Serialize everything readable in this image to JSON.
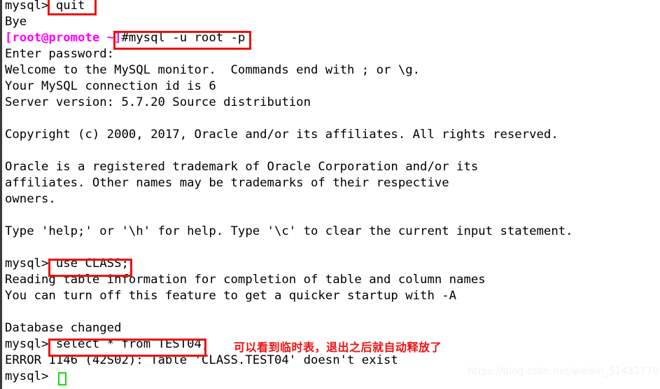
{
  "terminal": {
    "background_color": "#ffffff",
    "text_color": "#000000",
    "prompt_color": "#ff00ff",
    "annotation_color": "#ee1111",
    "cursor_color": "#11dd11",
    "lines": [
      {
        "prompt": "mysql>",
        "text": " quit"
      },
      {
        "prompt": "",
        "text": "Bye"
      },
      {
        "prompt": "[root@promote ~]",
        "text": "#mysql -u root -p"
      },
      {
        "prompt": "",
        "text": "Enter password:"
      },
      {
        "prompt": "",
        "text": "Welcome to the MySQL monitor.  Commands end with ; or \\g."
      },
      {
        "prompt": "",
        "text": "Your MySQL connection id is 6"
      },
      {
        "prompt": "",
        "text": "Server version: 5.7.20 Source distribution"
      },
      {
        "prompt": "",
        "text": ""
      },
      {
        "prompt": "",
        "text": "Copyright (c) 2000, 2017, Oracle and/or its affiliates. All rights reserved."
      },
      {
        "prompt": "",
        "text": ""
      },
      {
        "prompt": "",
        "text": "Oracle is a registered trademark of Oracle Corporation and/or its"
      },
      {
        "prompt": "",
        "text": "affiliates. Other names may be trademarks of their respective"
      },
      {
        "prompt": "",
        "text": "owners."
      },
      {
        "prompt": "",
        "text": ""
      },
      {
        "prompt": "",
        "text": "Type 'help;' or '\\h' for help. Type '\\c' to clear the current input statement."
      },
      {
        "prompt": "",
        "text": ""
      },
      {
        "prompt": "mysql>",
        "text": " use CLASS;"
      },
      {
        "prompt": "",
        "text": "Reading table information for completion of table and column names"
      },
      {
        "prompt": "",
        "text": "You can turn off this feature to get a quicker startup with -A"
      },
      {
        "prompt": "",
        "text": ""
      },
      {
        "prompt": "",
        "text": "Database changed"
      },
      {
        "prompt": "mysql>",
        "text": " select * from TEST04;"
      },
      {
        "prompt": "",
        "text": "ERROR 1146 (42S02): Table 'CLASS.TEST04' doesn't exist"
      },
      {
        "prompt": "mysql>",
        "text": " "
      }
    ]
  },
  "annotations": {
    "boxes": [
      {
        "label": "quit-command-highlight"
      },
      {
        "label": "mysql-login-command-highlight"
      },
      {
        "label": "use-class-command-highlight"
      },
      {
        "label": "select-test04-command-highlight"
      }
    ],
    "note_text": "可以看到临时表，退出之后就自动释放了"
  },
  "watermark": {
    "text": "https://blog.csdn.net/weixin_51432770"
  }
}
